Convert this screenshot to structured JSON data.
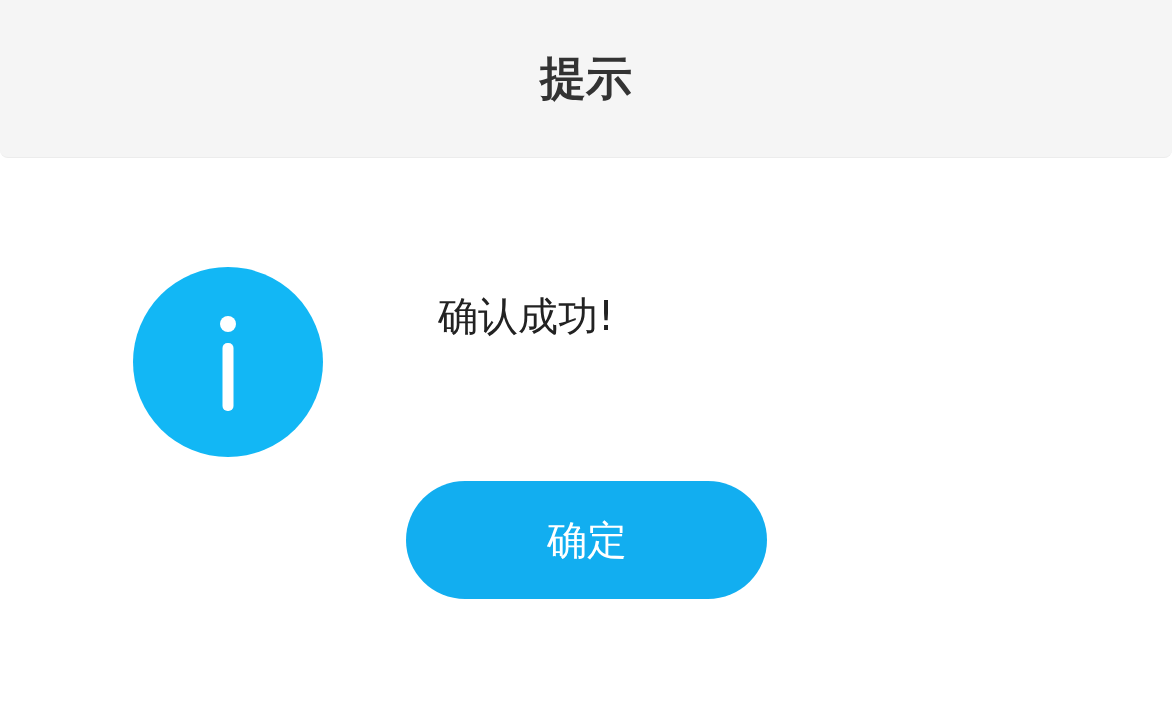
{
  "dialog": {
    "title": "提示",
    "message": "确认成功!",
    "buttons": [
      {
        "label": "确定",
        "kind": "primary"
      }
    ]
  }
}
